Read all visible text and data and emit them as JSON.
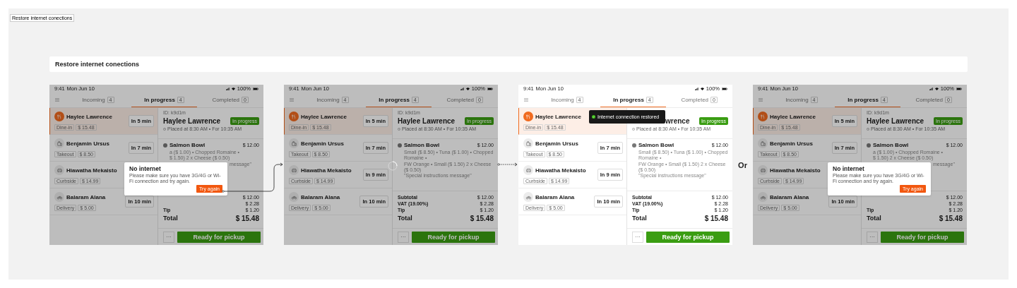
{
  "canvas_label": "Restore internet conections",
  "section_title": "Restore internet conections",
  "connectors": [
    {
      "dashed": false
    },
    {
      "dashed": true
    }
  ],
  "separator": "Or",
  "frames": [
    {
      "kind": "dialog",
      "dimmed": true,
      "status_bar": {
        "time": "9:41",
        "date": "Mon Jun 10",
        "battery": "100%"
      },
      "tabs": [
        {
          "label": "Incoming",
          "count": "4",
          "selected": false
        },
        {
          "label": "In progress",
          "count": "4",
          "selected": true
        },
        {
          "label": "Completed",
          "count": "0",
          "selected": false
        }
      ],
      "orders": [
        {
          "kind": "dine_in",
          "name": "Haylee Lawrence",
          "type": "Dine-in",
          "price": "$ 15.48",
          "eta": "In 5 min",
          "selected": true
        },
        {
          "kind": "takeout",
          "name": "Benjamin Ursus",
          "type": "Takeout",
          "price": "$ 8.50",
          "eta": "In 7 min",
          "selected": false
        },
        {
          "kind": "curbside",
          "name": "Hiawatha Mekaisto",
          "type": "Curbside",
          "price": "$ 14.99",
          "selected": false
        },
        {
          "kind": "delivery",
          "name": "Balaram Alana",
          "type": "Delivery",
          "price": "$ 5.00",
          "eta": "In 10 min",
          "selected": false
        }
      ],
      "detail": {
        "order_id": "ID: k9d1m",
        "name": "Haylee Lawrence",
        "placed": "Placed at 8:30 AM • For 10:35 AM",
        "status": "In progress",
        "items": [
          {
            "name": "Salmon Bowl",
            "price": "$ 12.00",
            "modifiers": [
              "a ($ 1.00) • Chopped Romaine •",
              "$ 1.50) 2 x Cheese ($ 0.50)",
              "message\""
            ]
          }
        ],
        "totals": [
          {
            "value": "$ 12.00"
          },
          {
            "value": "$ 2.28"
          },
          {
            "label": "Tip",
            "value": "$ 1.20"
          }
        ],
        "total": {
          "label": "Total",
          "value": "$ 15.48"
        }
      },
      "footer": {
        "more": "···",
        "action": "Ready for pickup"
      },
      "dialog": {
        "title": "No internet",
        "message": "Please make sure you have 3G/4G or Wi-Fi connection and try again.",
        "button": "Try again"
      }
    },
    {
      "kind": "loading",
      "dimmed": true,
      "status_bar": {
        "time": "9:41",
        "date": "Mon Jun 10",
        "battery": "100%"
      },
      "tabs": [
        {
          "label": "Incoming",
          "count": "4",
          "selected": false
        },
        {
          "label": "In progress",
          "count": "4",
          "selected": true
        },
        {
          "label": "Completed",
          "count": "0",
          "selected": false
        }
      ],
      "orders": [
        {
          "kind": "dine_in",
          "name": "Haylee Lawrence",
          "type": "Dine-in",
          "price": "$ 15.48",
          "eta": "In 5 min",
          "selected": true
        },
        {
          "kind": "takeout",
          "name": "Benjamin Ursus",
          "type": "Takeout",
          "price": "$ 8.50",
          "eta": "In 7 min",
          "selected": false
        },
        {
          "kind": "curbside",
          "name": "Hiawatha Mekaisto",
          "type": "Curbside",
          "price": "$ 14.99",
          "eta": "In 9 min",
          "selected": false
        },
        {
          "kind": "delivery",
          "name": "Balaram Alana",
          "type": "Delivery",
          "price": "$ 5.00",
          "eta": "In 10 min",
          "selected": false
        }
      ],
      "detail": {
        "order_id": "ID: k9d1m",
        "name": "Haylee Lawrence",
        "placed": "Placed at 8:30 AM • For 10:35 AM",
        "status": "In progress",
        "items": [
          {
            "name": "Salmon Bowl",
            "price": "$ 12.00",
            "modifiers": [
              "Small ($ 8.50) • Tuna ($ 1.00) • Chopped Romaine •",
              "FW Orange • Small ($ 1.50) 2 x Cheese ($ 0.50)",
              "\"Special instructions message\""
            ]
          }
        ],
        "totals": [
          {
            "label": "Subtotal",
            "value": "$ 12.00"
          },
          {
            "label": "VAT (19.00%)",
            "value": "$ 2.28"
          },
          {
            "label": "Tip",
            "value": "$ 1.20"
          }
        ],
        "total": {
          "label": "Total",
          "value": "$ 15.48"
        }
      },
      "footer": {
        "more": "···",
        "action": "Ready for pickup"
      }
    },
    {
      "kind": "toast",
      "dimmed": false,
      "status_bar": {
        "time": "9:41",
        "date": "Mon Jun 10",
        "battery": "100%"
      },
      "tabs": [
        {
          "label": "Incoming",
          "count": "4",
          "selected": false
        },
        {
          "label": "In progress",
          "count": "4",
          "selected": true
        },
        {
          "label": "Completed",
          "count": "0",
          "selected": false
        }
      ],
      "orders": [
        {
          "kind": "dine_in",
          "name": "Haylee Lawrence",
          "type": "Dine-in",
          "price": "$ 15.48",
          "selected": true
        },
        {
          "kind": "takeout",
          "name": "Benjamin Ursus",
          "type": "Takeout",
          "price": "$ 8.50",
          "eta": "In 7 min",
          "selected": false
        },
        {
          "kind": "curbside",
          "name": "Hiawatha Mekaisto",
          "type": "Curbside",
          "price": "$ 14.99",
          "eta": "In 9 min",
          "selected": false
        },
        {
          "kind": "delivery",
          "name": "Balaram Alana",
          "type": "Delivery",
          "price": "$ 5.00",
          "eta": "In 10 min",
          "selected": false
        }
      ],
      "detail": {
        "name": "wrence",
        "placed": "Placed at 8:30 AM • For 10:35 AM",
        "status": "In progress",
        "items": [
          {
            "name": "Salmon Bowl",
            "price": "$ 12.00",
            "modifiers": [
              "Small ($ 8.50) • Tuna ($ 1.00) • Chopped Romaine •",
              "FW Orange • Small ($ 1.50) 2 x Cheese ($ 0.50)",
              "\"Special instructions message\""
            ]
          }
        ],
        "totals": [
          {
            "label": "Subtotal",
            "value": "$ 12.00"
          },
          {
            "label": "VAT (19.00%)",
            "value": "$ 2.28"
          },
          {
            "label": "Tip",
            "value": "$ 1.20"
          }
        ],
        "total": {
          "label": "Total",
          "value": "$ 15.48"
        }
      },
      "footer": {
        "more": "···",
        "action": "Ready for pickup"
      },
      "toast": {
        "message": "Internet connection restored"
      }
    },
    {
      "kind": "dialog",
      "dimmed": true,
      "status_bar": {
        "time": "9:41",
        "date": "Mon Jun 10",
        "battery": "100%"
      },
      "tabs": [
        {
          "label": "Incoming",
          "count": "4",
          "selected": false
        },
        {
          "label": "In progress",
          "count": "4",
          "selected": true
        },
        {
          "label": "Completed",
          "count": "0",
          "selected": false
        }
      ],
      "orders": [
        {
          "kind": "dine_in",
          "name": "Haylee Lawrence",
          "type": "Dine-in",
          "price": "$ 15.48",
          "eta": "In 5 min",
          "selected": true
        },
        {
          "kind": "takeout",
          "name": "Benjamin Ursus",
          "type": "Takeout",
          "price": "$ 8.50",
          "eta": "In 7 min",
          "selected": false
        },
        {
          "kind": "curbside",
          "name": "Hiawatha Mekaisto",
          "type": "Curbside",
          "price": "$ 14.99",
          "selected": false
        },
        {
          "kind": "delivery",
          "name": "Balaram Alana",
          "type": "Delivery",
          "price": "$ 5.00",
          "eta": "In 10 min",
          "selected": false
        }
      ],
      "detail": {
        "order_id": "ID: k9d1m",
        "name": "Haylee Lawrence",
        "placed": "Placed at 8:30 AM • For 10:35 AM",
        "status": "In progress",
        "items": [
          {
            "name": "Salmon Bowl",
            "price": "$ 12.00",
            "modifiers": [
              "a ($ 1.00) • Chopped Romaine •",
              "$ 1.50) 2 x Cheese ($ 0.50)",
              "message\""
            ]
          }
        ],
        "totals": [
          {
            "value": "$ 12.00"
          },
          {
            "value": "$ 2.28"
          },
          {
            "label": "Tip",
            "value": "$ 1.20"
          }
        ],
        "total": {
          "label": "Total",
          "value": "$ 15.48"
        }
      },
      "footer": {
        "more": "···",
        "action": "Ready for pickup"
      },
      "dialog": {
        "title": "No internet",
        "message": "Please make sure you have 3G/4G or Wi-Fi connection and try again.",
        "button": "Try again"
      }
    }
  ]
}
